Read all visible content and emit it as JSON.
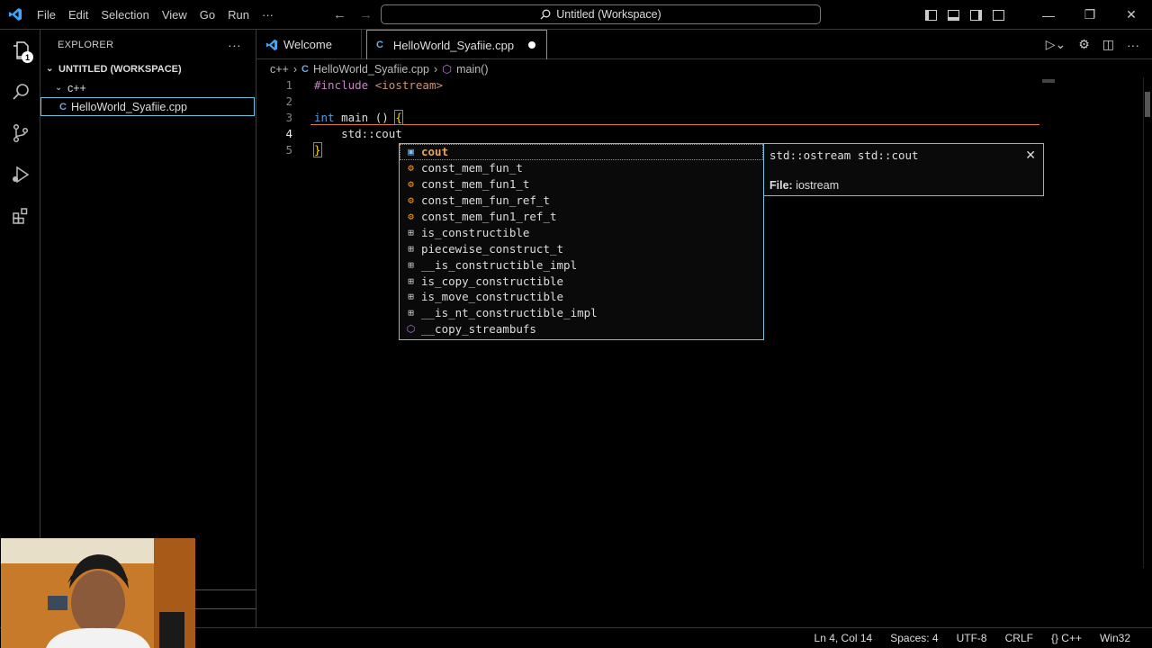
{
  "menu": [
    "File",
    "Edit",
    "Selection",
    "View",
    "Go",
    "Run",
    "···"
  ],
  "search": {
    "text": "Untitled (Workspace)"
  },
  "explorer": {
    "title": "EXPLORER",
    "more": "···",
    "workspace": "UNTITLED (WORKSPACE)",
    "folder": "c++",
    "file": "HelloWorld_Syafiie.cpp"
  },
  "activity": {
    "badge": "1"
  },
  "tabs": [
    {
      "label": "Welcome"
    },
    {
      "label": "HelloWorld_Syafiie.cpp",
      "modified": true
    }
  ],
  "breadcrumb": [
    "c++",
    "HelloWorld_Syafiie.cpp",
    "main()"
  ],
  "editor": {
    "lines": [
      {
        "num": "1",
        "inc": "#include",
        "hdr": "<iostream>"
      },
      {
        "num": "2"
      },
      {
        "num": "3",
        "kw": "int",
        "rest": " main () ",
        "brace": "{"
      },
      {
        "num": "4",
        "text": "    std::cout"
      },
      {
        "num": "5",
        "brace": "}"
      }
    ]
  },
  "suggest": {
    "items": [
      {
        "label": "cout",
        "icon": "variable-icon"
      },
      {
        "label": "const_mem_fun_t",
        "icon": "class-icon"
      },
      {
        "label": "const_mem_fun1_t",
        "icon": "class-icon"
      },
      {
        "label": "const_mem_fun_ref_t",
        "icon": "class-icon"
      },
      {
        "label": "const_mem_fun1_ref_t",
        "icon": "class-icon"
      },
      {
        "label": "is_constructible",
        "icon": "struct-icon"
      },
      {
        "label": "piecewise_construct_t",
        "icon": "struct-icon"
      },
      {
        "label": "__is_constructible_impl",
        "icon": "struct-icon"
      },
      {
        "label": "is_copy_constructible",
        "icon": "struct-icon"
      },
      {
        "label": "is_move_constructible",
        "icon": "struct-icon"
      },
      {
        "label": "__is_nt_constructible_impl",
        "icon": "struct-icon"
      },
      {
        "label": "__copy_streambufs",
        "icon": "function-icon"
      }
    ],
    "detail": {
      "signature": "std::ostream std::cout",
      "file_label": "File:",
      "file_value": "iostream",
      "close": "✕"
    }
  },
  "status": [
    "Ln 4, Col 14",
    "Spaces: 4",
    "UTF-8",
    "CRLF",
    "{} C++",
    "Win32"
  ],
  "colors": {
    "accent": "#e07a3c",
    "focus": "#6fc3df"
  }
}
